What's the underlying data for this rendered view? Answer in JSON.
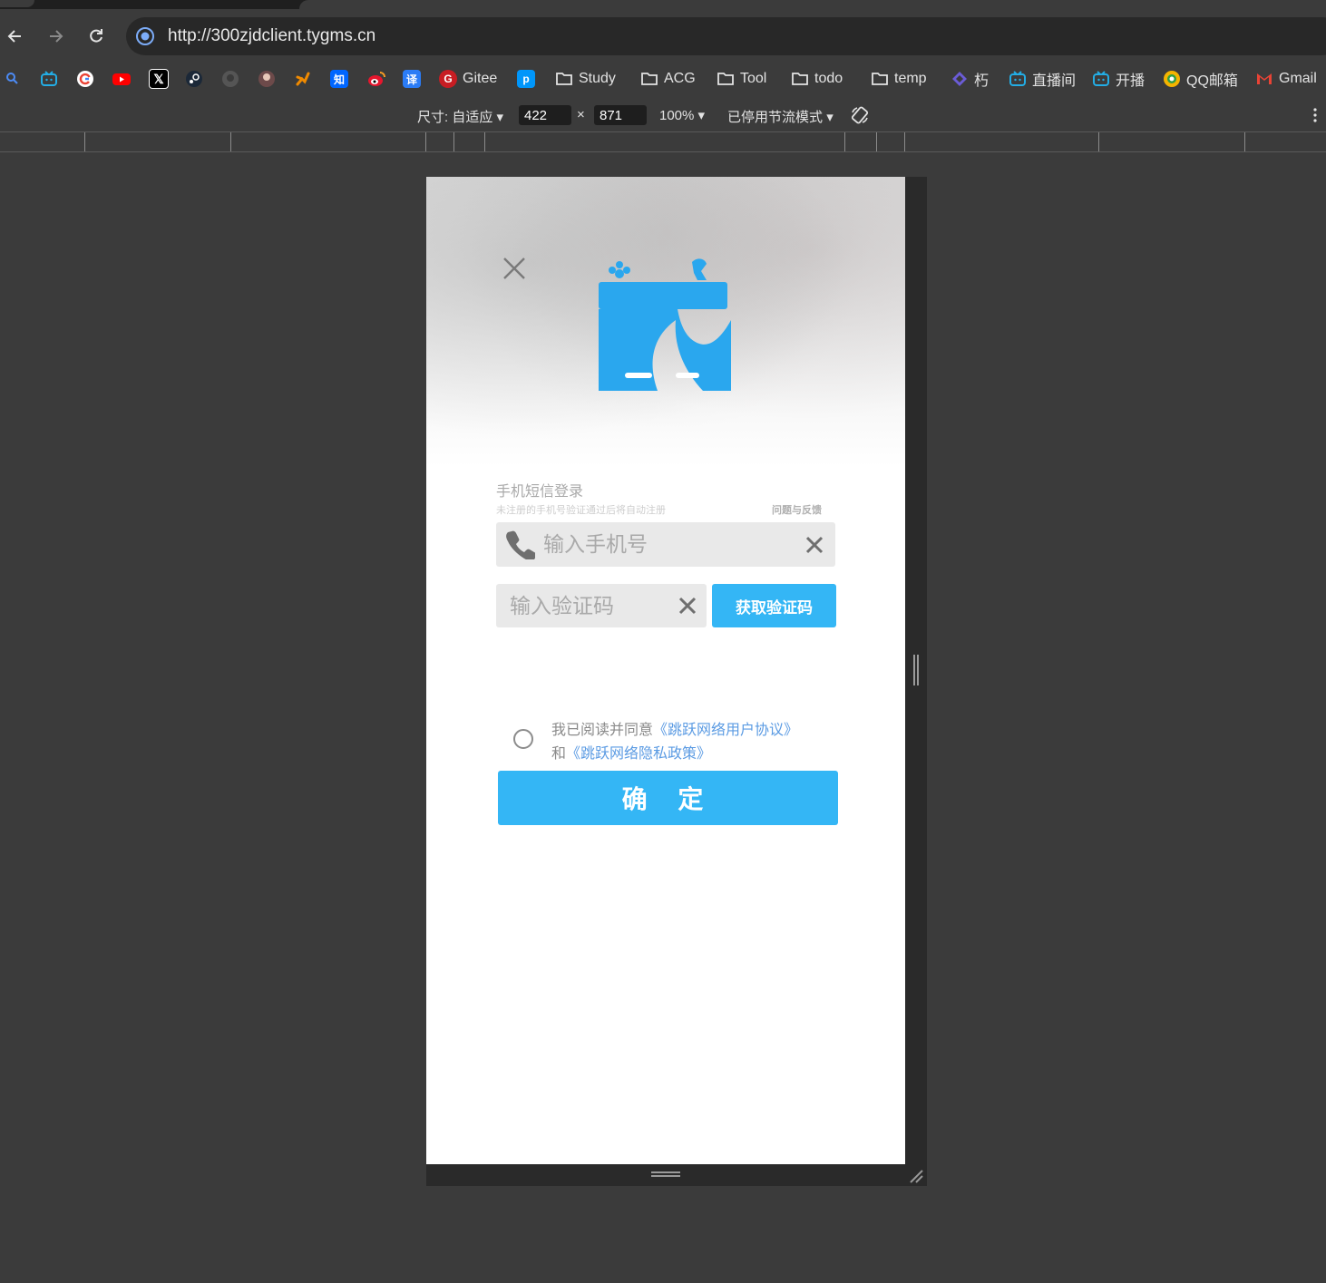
{
  "browser": {
    "url": "http://300zjdclient.tygms.cn",
    "bookmarks": [
      {
        "label": "",
        "icon": "search-icon",
        "color": "#4c8bf5"
      },
      {
        "label": "",
        "icon": "bilibili-icon",
        "color": "#23ade5"
      },
      {
        "label": "",
        "icon": "google-icon",
        "color": "#ffffff"
      },
      {
        "label": "",
        "icon": "youtube-icon",
        "color": "#ff0000"
      },
      {
        "label": "",
        "icon": "x-icon",
        "color": "#000000"
      },
      {
        "label": "",
        "icon": "steam-icon",
        "color": "#1b2838"
      },
      {
        "label": "",
        "icon": "github-icon",
        "color": "#555555"
      },
      {
        "label": "",
        "icon": "avatar-icon",
        "color": "#884444"
      },
      {
        "label": "",
        "icon": "runner-icon",
        "color": "#f08a00"
      },
      {
        "label": "",
        "icon": "zhihu-icon",
        "color": "#0066ff",
        "glyph": "知"
      },
      {
        "label": "",
        "icon": "weibo-icon",
        "color": "#e6162d"
      },
      {
        "label": "",
        "icon": "translate-icon",
        "color": "#2b7cf6",
        "glyph": "译"
      },
      {
        "label": "Gitee",
        "icon": "gitee-icon",
        "color": "#c71d23",
        "glyph": "G"
      },
      {
        "label": "",
        "icon": "pixiv-icon",
        "color": "#0096fa",
        "glyph": "p"
      },
      {
        "label": "Study",
        "icon": "folder-icon"
      },
      {
        "label": "ACG",
        "icon": "folder-icon"
      },
      {
        "label": "Tool",
        "icon": "folder-icon"
      },
      {
        "label": "todo",
        "icon": "folder-icon"
      },
      {
        "label": "temp",
        "icon": "folder-icon"
      },
      {
        "label": "朽",
        "icon": "diamond-icon",
        "color": "#6b5cd6"
      },
      {
        "label": "直播间",
        "icon": "bilibili-icon",
        "color": "#23ade5"
      },
      {
        "label": "开播",
        "icon": "bilibili-icon",
        "color": "#23ade5"
      },
      {
        "label": "QQ邮箱",
        "icon": "qqmail-icon",
        "color": "#f5b400"
      },
      {
        "label": "Gmail",
        "icon": "gmail-icon",
        "color": "#ea4335"
      }
    ],
    "devtools": {
      "size_label": "尺寸: 自适应",
      "width": "422",
      "times": "×",
      "height": "871",
      "zoom": "100%",
      "throttle": "已停用节流模式"
    }
  },
  "page": {
    "title": "手机短信登录",
    "subtitle": "未注册的手机号验证通过后将自动注册",
    "feedback": "问题与反馈",
    "phone_placeholder": "输入手机号",
    "code_placeholder": "输入验证码",
    "get_code": "获取验证码",
    "agree_prefix": "我已阅读并同意",
    "user_agreement": "《跳跃网络用户协议》",
    "and": "和",
    "privacy_policy": "《跳跃网络隐私政策》",
    "confirm": "确 定",
    "accent": "#34b6f5",
    "link_color": "#5b9be3"
  }
}
